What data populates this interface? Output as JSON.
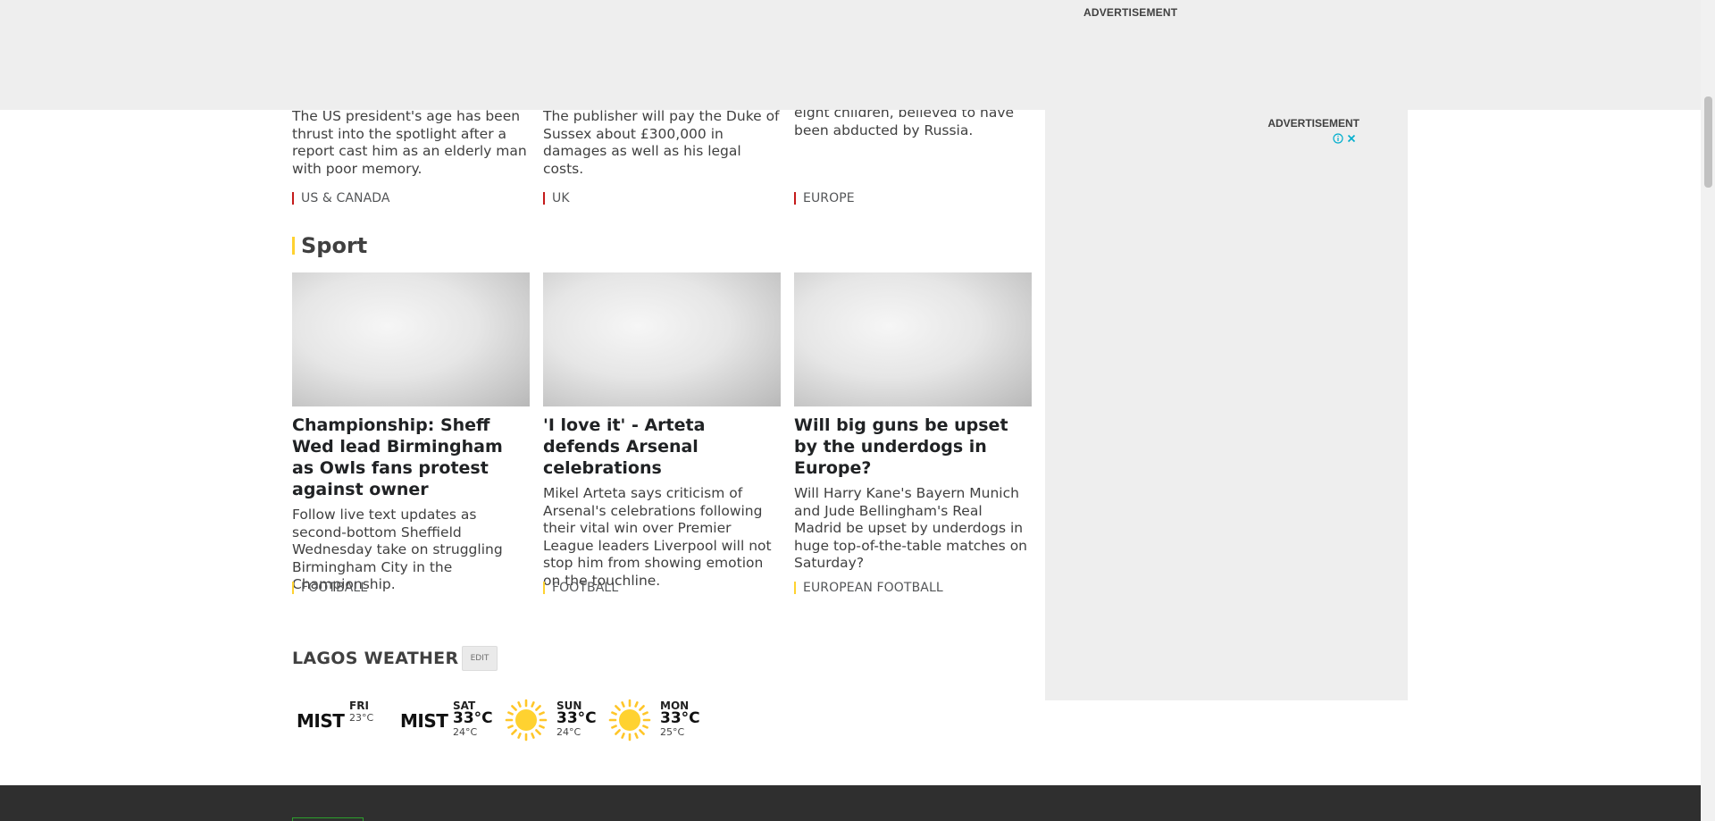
{
  "top_ad": {
    "label": "ADVERTISEMENT"
  },
  "news_cards": [
    {
      "summary": "The US president's age has been thrust into the spotlight after a report cast him as an elderly man with poor memory.",
      "tag": "US & CANADA"
    },
    {
      "summary": "The publisher will pay the Duke of Sussex about £300,000 in damages as well as his legal costs.",
      "tag": "UK"
    },
    {
      "summary": "eight children, believed to have been abducted by Russia.",
      "tag": "EUROPE"
    }
  ],
  "sport": {
    "heading": "Sport",
    "cards": [
      {
        "headline": "Championship: Sheff Wed lead Birmingham as Owls fans protest against owner",
        "summary": "Follow live text updates as second-bottom Sheffield Wednesday take on struggling Birmingham City in the Championship.",
        "tag": "FOOTBALL"
      },
      {
        "headline": "'I love it' - Arteta defends Arsenal celebrations",
        "summary": "Mikel Arteta says criticism of Arsenal's celebrations following their vital win over Premier League leaders Liverpool will not stop him from showing emotion on the touchline.",
        "tag": "FOOTBALL"
      },
      {
        "headline": "Will big guns be upset by the underdogs in Europe?",
        "summary": "Will Harry Kane's Bayern Munich and Jude Bellingham's Real Madrid be upset by underdogs in huge top-of-the-table matches on Saturday?",
        "tag": "EUROPEAN FOOTBALL"
      }
    ]
  },
  "weather": {
    "title": "LAGOS WEATHER",
    "edit_label": "EDIT",
    "days": [
      {
        "icon": "MIST",
        "day": "FRI",
        "high": "",
        "low": "23°C"
      },
      {
        "icon": "MIST",
        "day": "SAT",
        "high": "33°C",
        "low": "24°C"
      },
      {
        "icon": "sun-icon",
        "day": "SUN",
        "high": "33°C",
        "low": "24°C"
      },
      {
        "icon": "sun-icon",
        "day": "MON",
        "high": "33°C",
        "low": "25°C"
      }
    ]
  },
  "side_ad": {
    "label": "ADVERTISEMENT"
  },
  "colors": {
    "news_accent": "#c41a1a",
    "sport_accent": "#ffd230",
    "ad_background": "#eeeeee",
    "footer_background": "#2f2f2f",
    "ad_choices": "#00aecd"
  }
}
